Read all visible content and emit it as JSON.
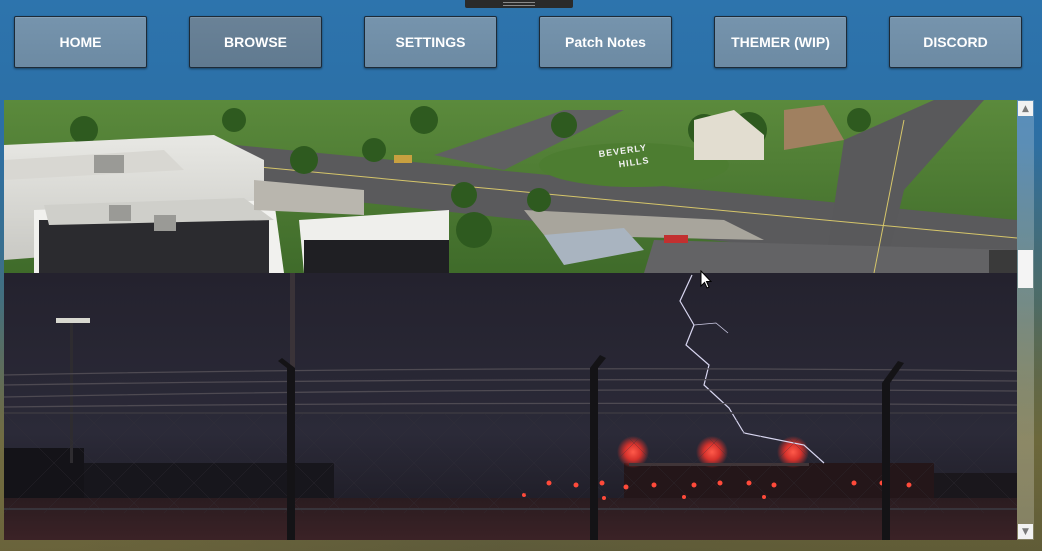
{
  "nav": {
    "buttons": [
      {
        "label": "HOME"
      },
      {
        "label": "BROWSE"
      },
      {
        "label": "SETTINGS"
      },
      {
        "label": "Patch Notes"
      },
      {
        "label": "THEMER (WIP)"
      },
      {
        "label": "DISCORD"
      }
    ]
  },
  "gallery": {
    "image_1": {
      "sign_line_1": "BEVERLY",
      "sign_line_2": "HILLS"
    },
    "image_2": {}
  },
  "scrollbar": {
    "up_icon": "arrow-up-icon",
    "down_icon": "arrow-down-icon"
  },
  "colors": {
    "background": "#2d74ad",
    "button": "#7694ad",
    "button_border": "#1d2a36",
    "button_text": "#ffffff"
  }
}
